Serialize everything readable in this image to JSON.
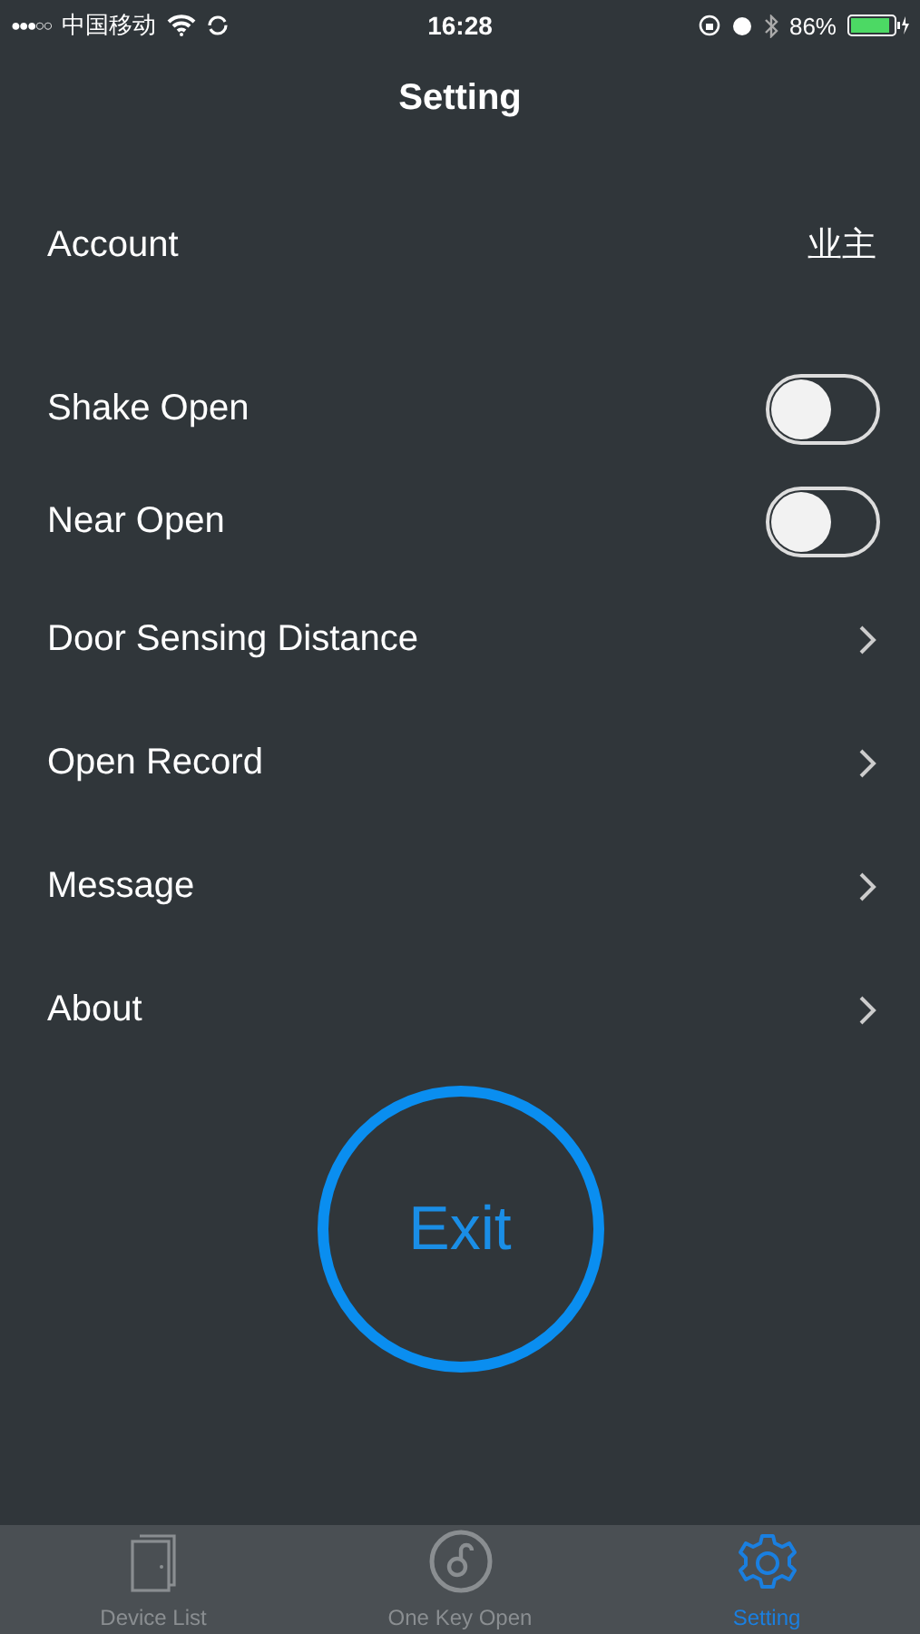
{
  "status_bar": {
    "signal": "●●●○○",
    "carrier": "中国移动",
    "time": "16:28",
    "battery": "86%"
  },
  "title": "Setting",
  "rows": [
    {
      "kind": "value",
      "label": "Account",
      "value": "业主"
    },
    {
      "kind": "toggle",
      "label": "Shake Open",
      "on": false
    },
    {
      "kind": "toggle",
      "label": "Near Open",
      "on": false
    },
    {
      "kind": "link",
      "label": "Door Sensing Distance"
    },
    {
      "kind": "link",
      "label": "Open Record"
    },
    {
      "kind": "link",
      "label": "Message"
    },
    {
      "kind": "link",
      "label": "About"
    }
  ],
  "exit_button": "Exit",
  "tabs": [
    {
      "label": "Device List",
      "selected": false
    },
    {
      "label": "One Key Open",
      "selected": false
    },
    {
      "label": "Setting",
      "selected": true
    }
  ]
}
